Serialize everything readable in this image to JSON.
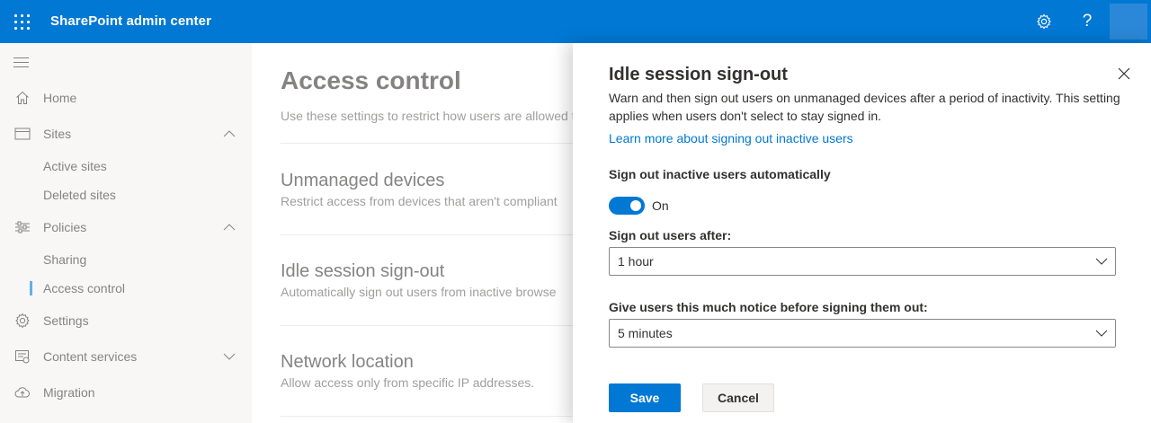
{
  "app": {
    "title": "SharePoint admin center"
  },
  "topbar": {
    "icons": [
      "waffle-icon",
      "gear-icon",
      "help-icon"
    ],
    "help_glyph": "?"
  },
  "nav": {
    "items": [
      {
        "label": "Home",
        "icon": "home-icon"
      },
      {
        "label": "Sites",
        "icon": "sites-icon",
        "expanded": true
      },
      {
        "label": "Active sites"
      },
      {
        "label": "Deleted sites"
      },
      {
        "label": "Policies",
        "icon": "policies-icon",
        "expanded": true
      },
      {
        "label": "Sharing"
      },
      {
        "label": "Access control",
        "selected": true
      },
      {
        "label": "Settings",
        "icon": "gear-icon"
      },
      {
        "label": "Content services",
        "icon": "content-services-icon",
        "expanded": false
      },
      {
        "label": "Migration",
        "icon": "migration-icon"
      }
    ]
  },
  "main": {
    "title": "Access control",
    "description": "Use these settings to restrict how users are allowed to",
    "sections": [
      {
        "title": "Unmanaged devices",
        "description": "Restrict access from devices that aren't compliant"
      },
      {
        "title": "Idle session sign-out",
        "description": "Automatically sign out users from inactive browse"
      },
      {
        "title": "Network location",
        "description": "Allow access only from specific IP addresses."
      }
    ]
  },
  "panel": {
    "title": "Idle session sign-out",
    "description": "Warn and then sign out users on unmanaged devices after a period of inactivity. This setting applies when users don't select to stay signed in.",
    "learn_link": "Learn more about signing out inactive users",
    "toggle_label": "Sign out inactive users automatically",
    "toggle_state": "On",
    "toggle_on": true,
    "signout_label": "Sign out users after:",
    "signout_value": "1 hour",
    "notice_label": "Give users this much notice before signing them out:",
    "notice_value": "5 minutes",
    "save_label": "Save",
    "cancel_label": "Cancel"
  },
  "colors": {
    "accent": "#0078d4",
    "nav_bg": "#f3f2f1",
    "text": "#323130",
    "muted": "#605e5c"
  }
}
